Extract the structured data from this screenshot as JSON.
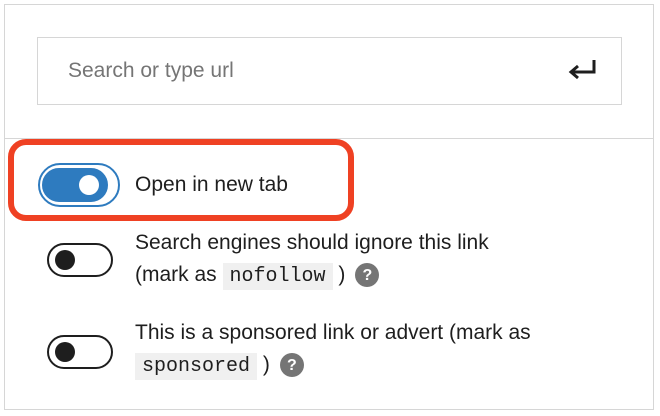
{
  "link_control": {
    "search": {
      "placeholder": "Search or type url",
      "value": "",
      "submit_icon": "enter-arrow-icon"
    },
    "settings": [
      {
        "label": "Open in new tab",
        "checked": true
      },
      {
        "label_prefix": "Search engines should ignore this link",
        "label_prefix_line2": "(mark as ",
        "keyword": "nofollow",
        "label_suffix": " )",
        "checked": false,
        "help_icon": "help-icon"
      },
      {
        "label_prefix": "This is a sponsored link or advert (mark as",
        "keyword": "sponsored",
        "label_suffix": " )",
        "checked": false,
        "help_icon": "help-icon"
      }
    ],
    "help_glyph": "?"
  },
  "colors": {
    "toggle_on": "#2e7bbf",
    "toggle_off_border": "#1e1e1e",
    "highlight": "#ef4123",
    "border": "#d6d6d6",
    "code_bg": "#f0f0f0",
    "placeholder": "#757575"
  }
}
